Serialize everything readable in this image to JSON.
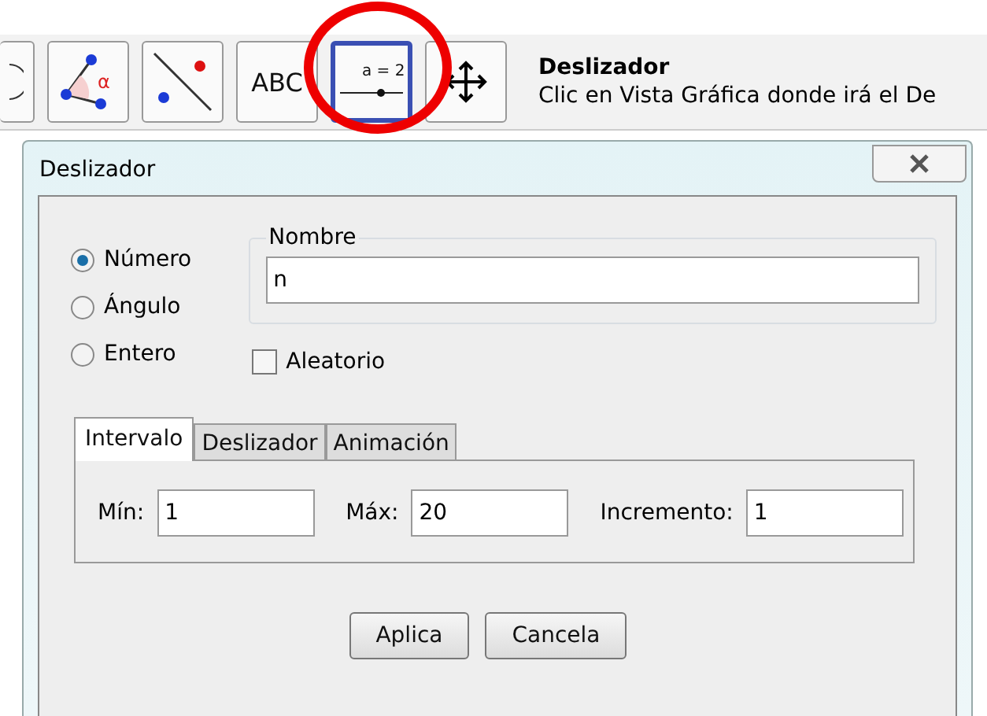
{
  "toolbar": {
    "tools": [
      {
        "kind": "circle",
        "selected": false,
        "highlighted": false
      },
      {
        "kind": "angle",
        "label": "α",
        "selected": false,
        "highlighted": false
      },
      {
        "kind": "line",
        "selected": false,
        "highlighted": false
      },
      {
        "kind": "text",
        "label": "ABC",
        "selected": false,
        "highlighted": false
      },
      {
        "kind": "slider",
        "label": "a = 2",
        "selected": true,
        "highlighted": true
      },
      {
        "kind": "move",
        "selected": false,
        "highlighted": false
      }
    ],
    "tool_name": "Deslizador",
    "tool_help": "Clic en Vista Gráfica donde irá el De"
  },
  "dialog": {
    "title": "Deslizador",
    "types": [
      {
        "label": "Número",
        "selected": true
      },
      {
        "label": "Ángulo",
        "selected": false
      },
      {
        "label": "Entero",
        "selected": false
      }
    ],
    "name_group": {
      "legend": "Nombre",
      "value": "n"
    },
    "random": {
      "label": "Aleatorio",
      "checked": false
    },
    "tabs": [
      {
        "label": "Intervalo",
        "selected": true
      },
      {
        "label": "Deslizador",
        "selected": false
      },
      {
        "label": "Animación",
        "selected": false
      }
    ],
    "fields": [
      {
        "label": "Mín:",
        "value": "1"
      },
      {
        "label": "Máx:",
        "value": "20"
      },
      {
        "label": "Incremento:",
        "value": "1"
      }
    ],
    "buttons": [
      "Aplica",
      "Cancela"
    ]
  }
}
